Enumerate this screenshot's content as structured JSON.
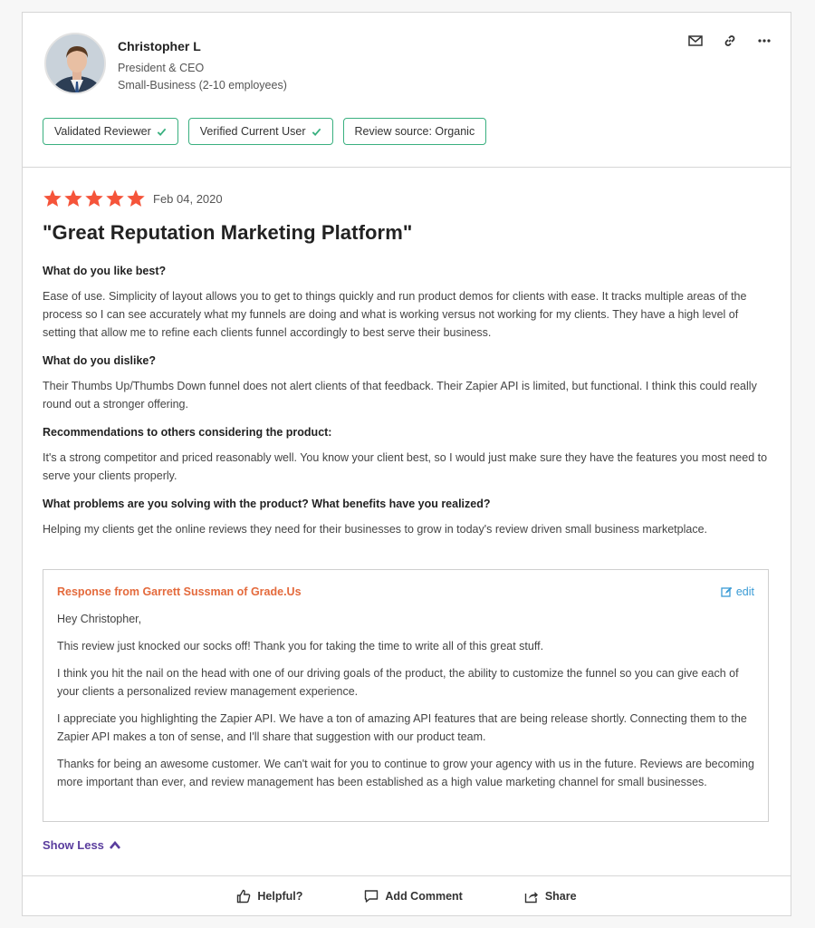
{
  "reviewer": {
    "name": "Christopher L",
    "title": "President & CEO",
    "company_size": "Small-Business (2-10 employees)"
  },
  "header_icons": [
    "mail-icon",
    "link-icon",
    "more-icon"
  ],
  "badges": [
    {
      "label": "Validated Reviewer",
      "check": true
    },
    {
      "label": "Verified Current User",
      "check": true
    },
    {
      "label": "Review source: Organic",
      "check": false
    }
  ],
  "review": {
    "rating": 5,
    "max_rating": 5,
    "date": "Feb 04, 2020",
    "title": "\"Great Reputation Marketing Platform\"",
    "qa": [
      {
        "question": "What do you like best?",
        "answer": "Ease of use. Simplicity of layout allows you to get to things quickly and run product demos for clients with ease. It tracks multiple areas of the process so I can see accurately what my funnels are doing and what is working versus not working for my clients. They have a high level of setting that allow me to refine each clients funnel accordingly to best serve their business."
      },
      {
        "question": "What do you dislike?",
        "answer": "Their Thumbs Up/Thumbs Down funnel does not alert clients of that feedback. Their Zapier API is limited, but functional. I think this could really round out a stronger offering."
      },
      {
        "question": "Recommendations to others considering the product:",
        "answer": "It's a strong competitor and priced reasonably well. You know your client best, so I would just make sure they have the features you most need to serve your clients properly."
      },
      {
        "question": "What problems are you solving with the product? What benefits have you realized?",
        "answer": "Helping my clients get the online reviews they need for their businesses to grow in today's review driven small business marketplace."
      }
    ]
  },
  "response": {
    "from": "Response from Garrett Sussman of Grade.Us",
    "edit_label": "edit",
    "paragraphs": [
      "Hey Christopher,",
      "This review just knocked our socks off! Thank you for taking the time to write all of this great stuff.",
      "I think you hit the nail on the head with one of our driving goals of the product, the ability to customize the funnel so you can give each of your clients a personalized review management experience.",
      "I appreciate you highlighting the Zapier API. We have a ton of amazing API features that are being release shortly. Connecting them to the Zapier API makes a ton of sense, and I'll share that suggestion with our product team.",
      "Thanks for being an awesome customer. We can't wait for you to continue to grow your agency with us in the future. Reviews are becoming more important than ever, and review management has been established as a high value marketing channel for small businesses."
    ]
  },
  "show_less_label": "Show Less",
  "footer": {
    "helpful_label": "Helpful?",
    "comment_label": "Add Comment",
    "share_label": "Share"
  },
  "colors": {
    "star": "#f5543a",
    "badge_border": "#39b07f",
    "response_from": "#e46a3c",
    "edit_link": "#3a9bd5",
    "show_less": "#5a3d9e"
  }
}
